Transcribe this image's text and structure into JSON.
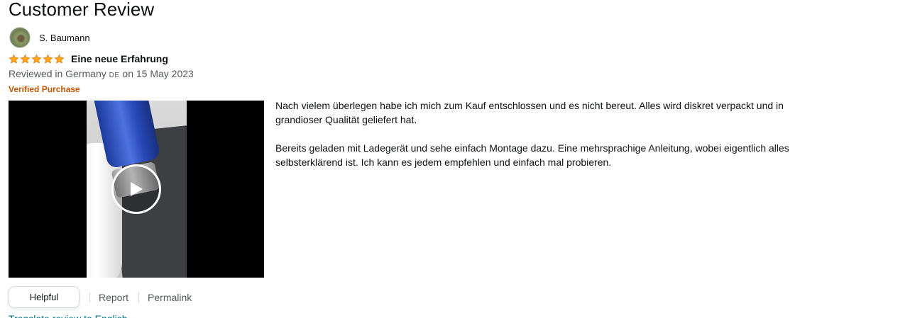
{
  "page": {
    "title": "Customer Review"
  },
  "reviewer": {
    "name": "S. Baumann"
  },
  "review": {
    "rating": 5,
    "rating_max": 5,
    "title": "Eine neue Erfahrung",
    "meta_prefix": "Reviewed in Germany",
    "country_code": "DE",
    "meta_date": "on 15 May 2023",
    "verified": "Verified Purchase",
    "paragraphs": [
      " Nach vielem überlegen habe ich mich zum Kauf entschlossen und es nicht bereut. Alles wird diskret verpackt und in grandioser Qualität geliefert hat.",
      "Bereits geladen mit Ladegerät und sehe einfach Montage dazu. Eine mehrsprachige Anleitung, wobei eigentlich alles selbsterklärend ist. Ich kann es jedem empfehlen und einfach mal probieren."
    ]
  },
  "actions": {
    "helpful": "Helpful",
    "report": "Report",
    "permalink": "Permalink",
    "translate": "Translate review to English"
  },
  "colors": {
    "star": "#ffa41c",
    "verified": "#c45500",
    "link": "#007185",
    "muted": "#565959"
  },
  "icons": {
    "star": "star-icon",
    "play": "play-icon"
  }
}
